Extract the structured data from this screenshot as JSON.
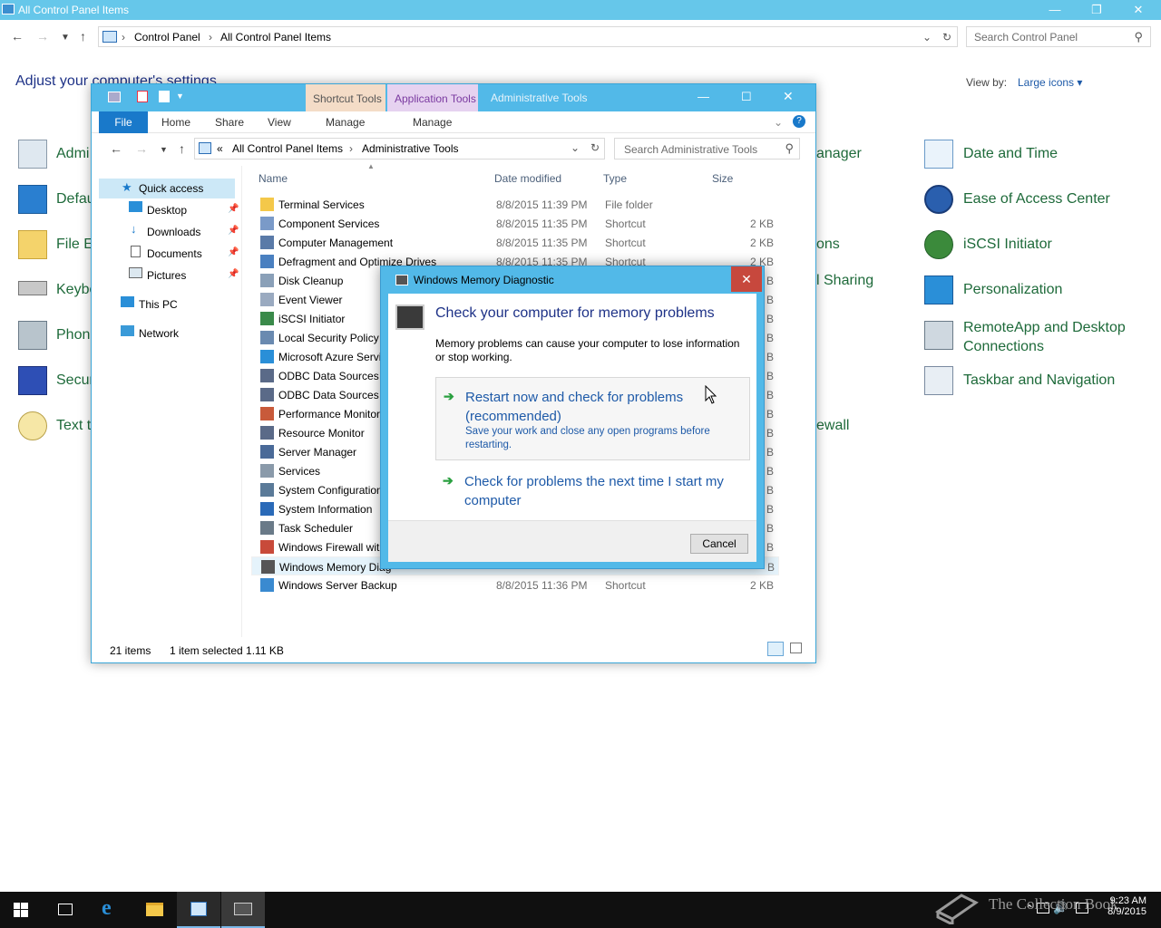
{
  "control_panel": {
    "title": "All Control Panel Items",
    "breadcrumb": [
      "Control Panel",
      "All Control Panel Items"
    ],
    "search_placeholder": "Search Control Panel",
    "heading": "Adjust your computer's settings",
    "view_by_label": "View by:",
    "view_by_value": "Large icons",
    "left_items": [
      "Admi",
      "Defau",
      "File Ex",
      "Keybo",
      "Phone",
      "Secur",
      "Text to"
    ],
    "mid_items": [
      "anager",
      "ons",
      "l Sharing",
      "ewall"
    ],
    "right_items": [
      "Date and Time",
      "Ease of Access Center",
      "iSCSI Initiator",
      "Personalization",
      "RemoteApp and Desktop Connections",
      "Taskbar and Navigation"
    ]
  },
  "explorer": {
    "title": "Administrative Tools",
    "context_tabs": [
      "Shortcut Tools",
      "Application Tools"
    ],
    "ribbon_tabs": [
      "File",
      "Home",
      "Share",
      "View",
      "Manage",
      "Manage"
    ],
    "breadcrumb": [
      "All Control Panel Items",
      "Administrative Tools"
    ],
    "breadcrumb_prefix": "«",
    "search_placeholder": "Search Administrative Tools",
    "sidebar": {
      "quick_access": "Quick access",
      "items": [
        "Desktop",
        "Downloads",
        "Documents",
        "Pictures"
      ],
      "this_pc": "This PC",
      "network": "Network"
    },
    "columns": {
      "name": "Name",
      "date": "Date modified",
      "type": "Type",
      "size": "Size"
    },
    "rows": [
      {
        "name": "Terminal Services",
        "date": "8/8/2015 11:39 PM",
        "type": "File folder",
        "size": ""
      },
      {
        "name": "Component Services",
        "date": "8/8/2015 11:35 PM",
        "type": "Shortcut",
        "size": "2 KB"
      },
      {
        "name": "Computer Management",
        "date": "8/8/2015 11:35 PM",
        "type": "Shortcut",
        "size": "2 KB"
      },
      {
        "name": "Defragment and Optimize Drives",
        "date": "8/8/2015 11:35 PM",
        "type": "Shortcut",
        "size": "2 KB"
      },
      {
        "name": "Disk Cleanup",
        "date": "",
        "type": "",
        "size": "B"
      },
      {
        "name": "Event Viewer",
        "date": "",
        "type": "",
        "size": "B"
      },
      {
        "name": "iSCSI Initiator",
        "date": "",
        "type": "",
        "size": "B"
      },
      {
        "name": "Local Security Policy",
        "date": "",
        "type": "",
        "size": "B"
      },
      {
        "name": "Microsoft Azure Servi",
        "date": "",
        "type": "",
        "size": "B"
      },
      {
        "name": "ODBC Data Sources (3",
        "date": "",
        "type": "",
        "size": "B"
      },
      {
        "name": "ODBC Data Sources (6",
        "date": "",
        "type": "",
        "size": "B"
      },
      {
        "name": "Performance Monitor",
        "date": "",
        "type": "",
        "size": "B"
      },
      {
        "name": "Resource Monitor",
        "date": "",
        "type": "",
        "size": "B"
      },
      {
        "name": "Server Manager",
        "date": "",
        "type": "",
        "size": "B"
      },
      {
        "name": "Services",
        "date": "",
        "type": "",
        "size": "B"
      },
      {
        "name": "System Configuration",
        "date": "",
        "type": "",
        "size": "B"
      },
      {
        "name": "System Information",
        "date": "",
        "type": "",
        "size": "B"
      },
      {
        "name": "Task Scheduler",
        "date": "",
        "type": "",
        "size": "B"
      },
      {
        "name": "Windows Firewall with",
        "date": "",
        "type": "",
        "size": "B"
      },
      {
        "name": "Windows Memory Diag",
        "date": "",
        "type": "",
        "size": "B"
      },
      {
        "name": "Windows Server Backup",
        "date": "8/8/2015 11:36 PM",
        "type": "Shortcut",
        "size": "2 KB"
      }
    ],
    "status": {
      "count": "21 items",
      "selected": "1 item selected  1.11 KB"
    }
  },
  "dialog": {
    "title": "Windows Memory Diagnostic",
    "heading": "Check your computer for memory problems",
    "description": "Memory problems can cause your computer to lose information or stop working.",
    "option1_title": "Restart now and check for problems (recommended)",
    "option1_sub": "Save your work and close any open programs before restarting.",
    "option2_title": "Check for problems the next time I start my computer",
    "cancel": "Cancel"
  },
  "taskbar": {
    "time": "9:23 AM",
    "date": "8/9/2015",
    "watermark": "The Collection Book"
  },
  "colors": {
    "accent": "#52b9e8",
    "link_green": "#1a6e3c",
    "link_blue": "#1e5aa8"
  }
}
